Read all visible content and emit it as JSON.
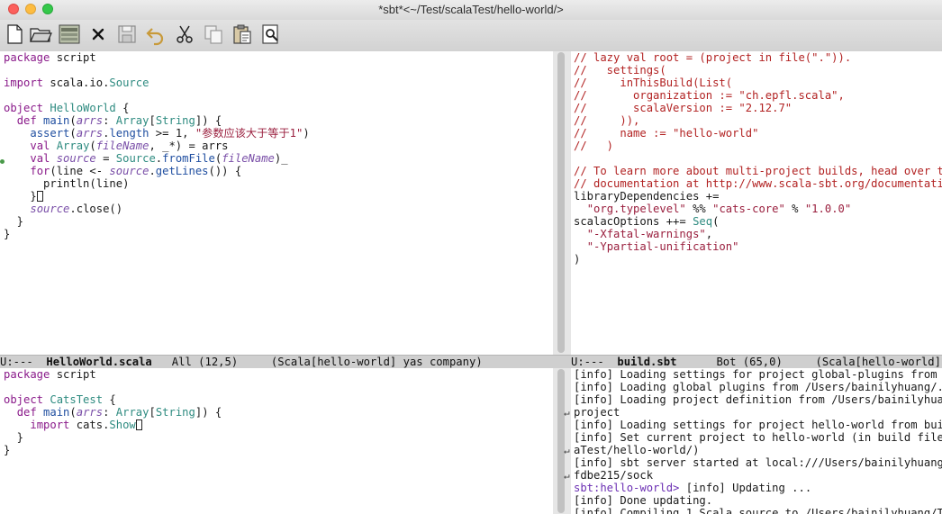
{
  "window": {
    "title": "*sbt*<~/Test/scalaTest/hello-world/>"
  },
  "toolbar": {
    "items": [
      "new-file-icon",
      "open-folder-icon",
      "dired-icon",
      "close-icon",
      "save-icon",
      "undo-icon",
      "cut-icon",
      "copy-icon",
      "paste-icon",
      "search-icon"
    ]
  },
  "editor_tl": {
    "lines": [
      [
        [
          "k",
          "package"
        ],
        [
          "n",
          " script"
        ]
      ],
      [
        [
          "n",
          ""
        ]
      ],
      [
        [
          "k",
          "import"
        ],
        [
          "n",
          " scala.io."
        ],
        [
          "t",
          "Source"
        ]
      ],
      [
        [
          "n",
          ""
        ]
      ],
      [
        [
          "k",
          "object"
        ],
        [
          "n",
          " "
        ],
        [
          "t",
          "HelloWorld"
        ],
        [
          "n",
          " {"
        ]
      ],
      [
        [
          "n",
          "  "
        ],
        [
          "k",
          "def"
        ],
        [
          "n",
          " "
        ],
        [
          "fnn",
          "main"
        ],
        [
          "n",
          "("
        ],
        [
          "v",
          "arrs"
        ],
        [
          "n",
          ": "
        ],
        [
          "t",
          "Array"
        ],
        [
          "n",
          "["
        ],
        [
          "t",
          "String"
        ],
        [
          "n",
          "]) {"
        ]
      ],
      [
        [
          "n",
          "    "
        ],
        [
          "fnn",
          "assert"
        ],
        [
          "n",
          "("
        ],
        [
          "v",
          "arrs"
        ],
        [
          "n",
          "."
        ],
        [
          "fnn",
          "length"
        ],
        [
          "n",
          " >= 1, "
        ],
        [
          "s",
          "\"参数应该大于等于1\""
        ],
        [
          "n",
          ")"
        ]
      ],
      [
        [
          "n",
          "    "
        ],
        [
          "k",
          "val"
        ],
        [
          "n",
          " "
        ],
        [
          "t",
          "Array"
        ],
        [
          "n",
          "("
        ],
        [
          "v",
          "fileName"
        ],
        [
          "n",
          ", _*) = arrs"
        ]
      ],
      [
        [
          "n",
          "    "
        ],
        [
          "k",
          "val"
        ],
        [
          "n",
          " "
        ],
        [
          "v",
          "source"
        ],
        [
          "n",
          " = "
        ],
        [
          "t",
          "Source"
        ],
        [
          "n",
          "."
        ],
        [
          "fnn",
          "fromFile"
        ],
        [
          "n",
          "("
        ],
        [
          "v",
          "fileName"
        ],
        [
          "n",
          ")_"
        ]
      ],
      [
        [
          "n",
          "    "
        ],
        [
          "k",
          "for"
        ],
        [
          "n",
          "(line <- "
        ],
        [
          "vi",
          "source"
        ],
        [
          "n",
          "."
        ],
        [
          "fnn",
          "getLines"
        ],
        [
          "n",
          "()) {"
        ]
      ],
      [
        [
          "n",
          "      println(line)"
        ]
      ],
      [
        [
          "n",
          "    }"
        ],
        [
          "cursor",
          ""
        ]
      ],
      [
        [
          "n",
          "    "
        ],
        [
          "vi",
          "source"
        ],
        [
          "n",
          ".close()"
        ]
      ],
      [
        [
          "n",
          "  }"
        ]
      ],
      [
        [
          "n",
          "}"
        ]
      ]
    ]
  },
  "editor_tr": {
    "lines": [
      [
        [
          "c",
          "// lazy val root = (project in file(\".\"))."
        ]
      ],
      [
        [
          "c",
          "//   settings("
        ]
      ],
      [
        [
          "c",
          "//     inThisBuild(List("
        ]
      ],
      [
        [
          "c",
          "//       organization := \"ch.epfl.scala\","
        ]
      ],
      [
        [
          "c",
          "//       scalaVersion := \"2.12.7\""
        ]
      ],
      [
        [
          "c",
          "//     )),"
        ]
      ],
      [
        [
          "c",
          "//     name := \"hello-world\""
        ]
      ],
      [
        [
          "c",
          "//   )"
        ]
      ],
      [
        [
          "n",
          ""
        ]
      ],
      [
        [
          "c",
          "// To learn more about multi-project builds, head over to t"
        ]
      ],
      [
        [
          "c",
          "// documentation at http://www.scala-sbt.org/documentation."
        ]
      ],
      [
        [
          "n",
          "libraryDependencies +="
        ]
      ],
      [
        [
          "n",
          "  "
        ],
        [
          "s",
          "\"org.typelevel\""
        ],
        [
          "n",
          " %% "
        ],
        [
          "s",
          "\"cats-core\""
        ],
        [
          "n",
          " % "
        ],
        [
          "s",
          "\"1.0.0\""
        ]
      ],
      [
        [
          "n",
          "scalacOptions ++= "
        ],
        [
          "t",
          "Seq"
        ],
        [
          "n",
          "("
        ]
      ],
      [
        [
          "n",
          "  "
        ],
        [
          "s",
          "\"-Xfatal-warnings\""
        ],
        [
          "n",
          ","
        ]
      ],
      [
        [
          "n",
          "  "
        ],
        [
          "s",
          "\"-Ypartial-unification\""
        ]
      ],
      [
        [
          "n",
          ")"
        ]
      ]
    ]
  },
  "modeline_left": {
    "prefix": "U:---  ",
    "buffer": "HelloWorld.scala",
    "rest": "   All (12,5)     (Scala[hello-world] yas company)"
  },
  "modeline_right": {
    "prefix": "U:---  ",
    "buffer": "build.sbt",
    "rest": "      Bot (65,0)     (Scala[hello-world] yas"
  },
  "editor_bl": {
    "lines": [
      [
        [
          "k",
          "package"
        ],
        [
          "n",
          " script"
        ]
      ],
      [
        [
          "n",
          ""
        ]
      ],
      [
        [
          "k",
          "object"
        ],
        [
          "n",
          " "
        ],
        [
          "t",
          "CatsTest"
        ],
        [
          "n",
          " {"
        ]
      ],
      [
        [
          "n",
          "  "
        ],
        [
          "k",
          "def"
        ],
        [
          "n",
          " "
        ],
        [
          "fnn",
          "main"
        ],
        [
          "n",
          "("
        ],
        [
          "v",
          "arrs"
        ],
        [
          "n",
          ": "
        ],
        [
          "t",
          "Array"
        ],
        [
          "n",
          "["
        ],
        [
          "t",
          "String"
        ],
        [
          "n",
          "]) {"
        ]
      ],
      [
        [
          "n",
          "    "
        ],
        [
          "k",
          "import"
        ],
        [
          "n",
          " cats."
        ],
        [
          "t",
          "Show"
        ],
        [
          "cursor",
          ""
        ]
      ],
      [
        [
          "n",
          "  }"
        ]
      ],
      [
        [
          "n",
          "}"
        ]
      ]
    ]
  },
  "sbt_console": {
    "lines": [
      [
        [
          "n",
          "[info] Loading settings for project global-plugins from pl"
        ]
      ],
      [
        [
          "n",
          "[info] Loading global plugins from /Users/bainilyhuang/.sbt"
        ]
      ],
      [
        [
          "n",
          "[info] Loading project definition from /Users/bainilyhuang/"
        ]
      ],
      [
        [
          "n",
          "project"
        ]
      ],
      [
        [
          "n",
          "[info] Loading settings for project hello-world from build."
        ]
      ],
      [
        [
          "n",
          "[info] Set current project to hello-world (in build file:/U"
        ]
      ],
      [
        [
          "n",
          "aTest/hello-world/)"
        ]
      ],
      [
        [
          "n",
          "[info] sbt server started at local:///Users/bainilyhuang/.s"
        ]
      ],
      [
        [
          "n",
          "fdbe215/sock"
        ]
      ],
      [
        [
          "prompt",
          "sbt:hello-world> "
        ],
        [
          "n",
          "[info] Updating ..."
        ]
      ],
      [
        [
          "n",
          "[info] Done updating."
        ]
      ],
      [
        [
          "n",
          "[info] Compiling 1 Scala source to /Users/bainilyhuang/Test"
        ]
      ]
    ]
  }
}
